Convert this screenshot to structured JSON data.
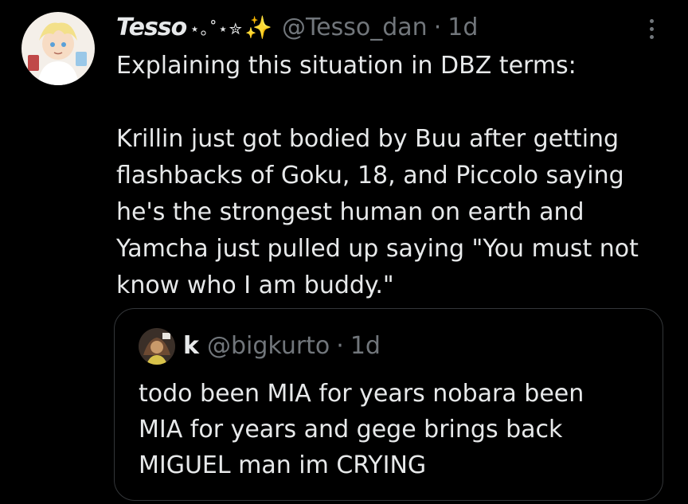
{
  "tweet": {
    "display_name": "Tesso",
    "name_decoration": "⋆｡˚⋆✮",
    "name_sparkle": "✨",
    "handle": "@Tesso_dan",
    "separator": "·",
    "time": "1d",
    "avatar_icon": "anime-character-avatar",
    "text_lines": [
      "Explaining this situation in DBZ terms:",
      "",
      "Krillin just got bodied by Buu after getting",
      "flashbacks of Goku, 18, and Piccolo saying",
      "he's the strongest human on earth and",
      "Yamcha just pulled up saying \"You must not",
      "know who I am buddy.\""
    ]
  },
  "quote": {
    "display_name": "k",
    "handle": "@bigkurto",
    "separator": "·",
    "time": "1d",
    "avatar_icon": "user-avatar",
    "text_lines": [
      "todo been MIA for years nobara been",
      "MIA for years and gege brings back",
      "MIGUEL man im CRYING"
    ]
  },
  "colors": {
    "background": "#000000",
    "primary_text": "#e7e9ea",
    "secondary_text": "#71767b",
    "border": "#333639"
  }
}
